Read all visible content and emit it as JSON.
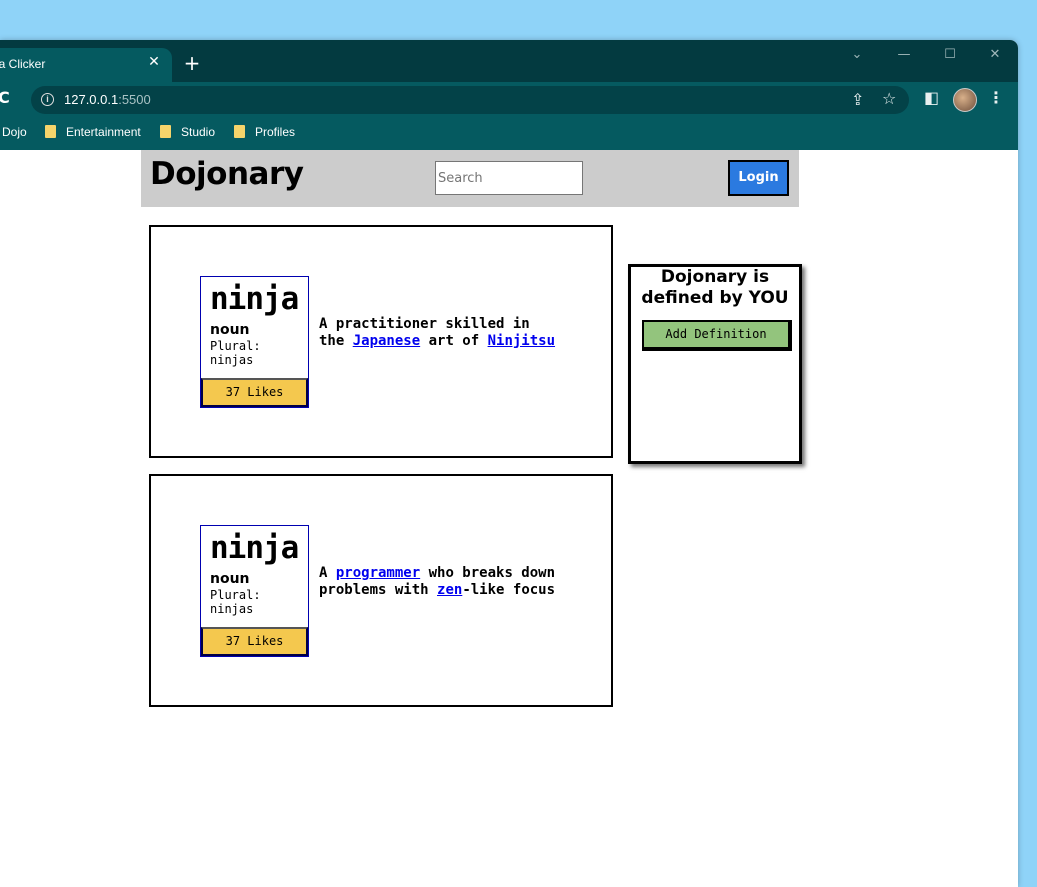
{
  "browser": {
    "tab_title": "Ninja Clicker",
    "url_host": "127.0.0.1",
    "url_port": ":5500",
    "bookmarks": [
      "Dojo",
      "Entertainment",
      "Studio",
      "Profiles"
    ]
  },
  "site": {
    "logo": "Dojonary",
    "search_placeholder": "Search",
    "login_label": "Login"
  },
  "entries": [
    {
      "word": "ninja",
      "part_of_speech": "noun",
      "plural_label": "Plural:",
      "plural": "ninjas",
      "likes": "37 Likes",
      "def_1": "A practitioner skilled in the ",
      "link_1": "Japanese",
      "def_2": " art of ",
      "link_2": "Ninjitsu",
      "def_3": ""
    },
    {
      "word": "ninja",
      "part_of_speech": "noun",
      "plural_label": "Plural:",
      "plural": "ninjas",
      "likes": "37 Likes",
      "def_1": "A ",
      "link_1": "programmer",
      "def_2": " who breaks down problems with ",
      "link_2": "zen",
      "def_3": "-like focus"
    }
  ],
  "sidebar": {
    "title": "Dojonary is defined by YOU",
    "add_button": "Add Definition"
  },
  "colors": {
    "browser_frame": "#055a60",
    "desktop": "#8fd3f8",
    "login_button": "#2b7ae0",
    "likes_button": "#f4c84e",
    "add_button": "#93c47d"
  }
}
